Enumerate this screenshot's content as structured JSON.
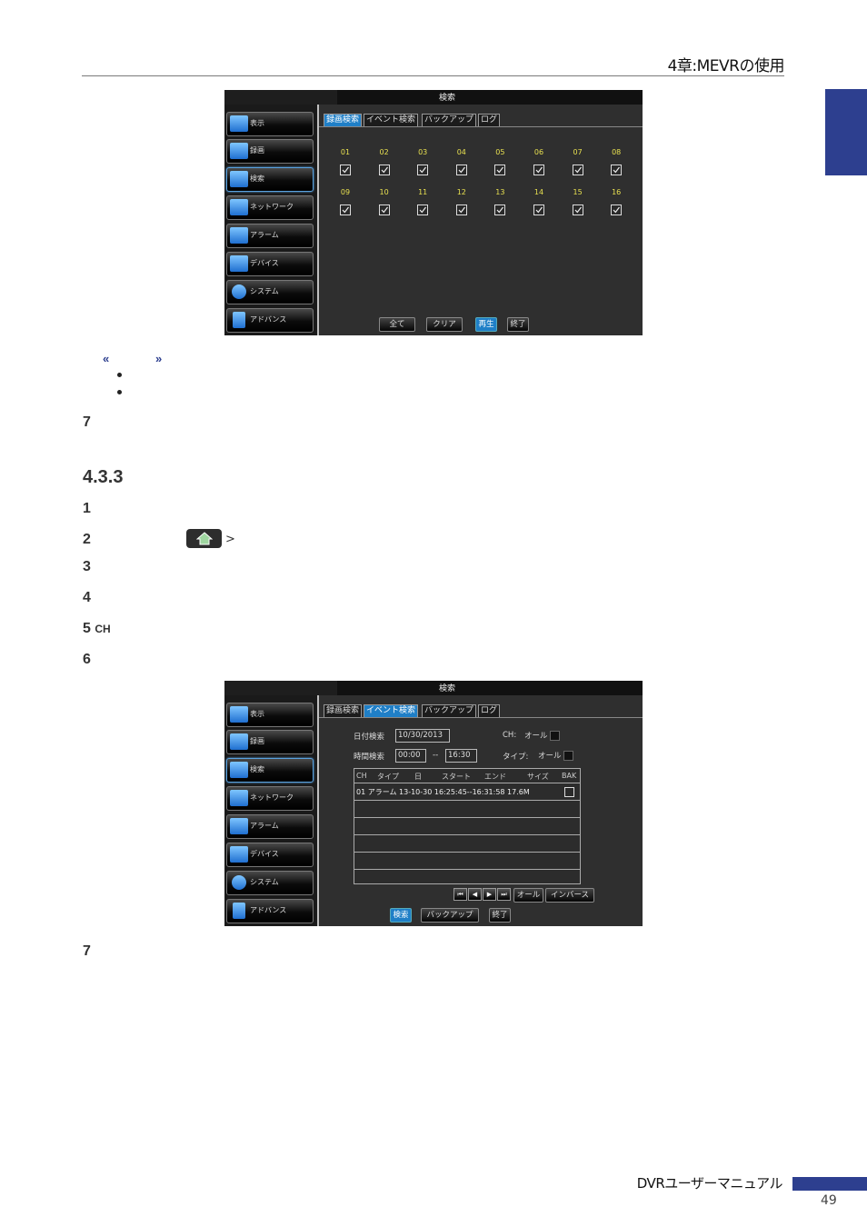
{
  "header": {
    "chapter": "4章:MEVRの使用"
  },
  "footer": {
    "title": "DVRユーザーマニュアル",
    "page_number": "49"
  },
  "body": {
    "quote_open": "«",
    "quote_close": "»",
    "steps_a": [
      "7"
    ],
    "section_number": "4.3.3",
    "steps_b": [
      "1",
      "2",
      "3",
      "4",
      "5",
      "6",
      "7"
    ],
    "step5_suffix": "CH",
    "gt_symbol": ">"
  },
  "dvr1": {
    "window_title": "検索",
    "sidebar": [
      "表示",
      "録画",
      "検索",
      "ネットワーク",
      "アラーム",
      "デバイス",
      "システム",
      "アドバンス"
    ],
    "tabs": [
      "録画検索",
      "イベント検索",
      "バックアップ",
      "ログ"
    ],
    "active_tab": 0,
    "channels_row1": [
      "01",
      "02",
      "03",
      "04",
      "05",
      "06",
      "07",
      "08"
    ],
    "channels_row2": [
      "09",
      "10",
      "11",
      "12",
      "13",
      "14",
      "15",
      "16"
    ],
    "buttons": {
      "all": "全て",
      "clear": "クリア",
      "play": "再生",
      "exit": "終了"
    }
  },
  "dvr2": {
    "window_title": "検索",
    "sidebar": [
      "表示",
      "録画",
      "検索",
      "ネットワーク",
      "アラーム",
      "デバイス",
      "システム",
      "アドバンス"
    ],
    "tabs": [
      "録画検索",
      "イベント検索",
      "バックアップ",
      "ログ"
    ],
    "active_tab": 1,
    "date_label": "日付検索",
    "date_value": "10/30/2013",
    "ch_label": "CH:",
    "ch_value": "オール",
    "time_label": "時間検索",
    "time_from": "00:00",
    "time_sep": "--",
    "time_to": "16:30",
    "type_label": "タイプ:",
    "type_value": "オール",
    "table_headers": [
      "CH",
      "タイプ",
      "日",
      "スタート",
      "エンド",
      "サイズ",
      "BAK"
    ],
    "table_rows": [
      "01 アラーム 13-10-30 16:25:45--16:31:58 17.6M"
    ],
    "nav_buttons": {
      "all": "オール",
      "inverse": "インバース"
    },
    "buttons": {
      "search": "検索",
      "backup": "バックアップ",
      "exit": "終了"
    }
  }
}
